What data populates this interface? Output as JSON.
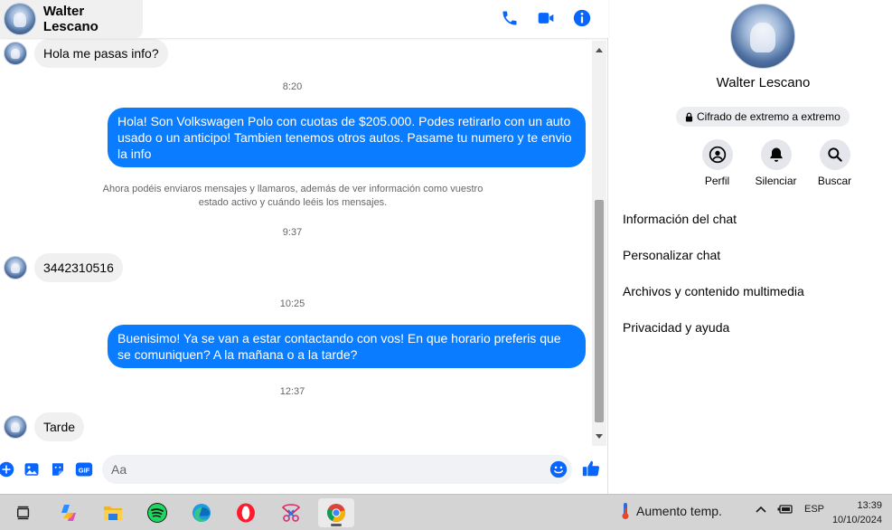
{
  "chat": {
    "contact_name": "Walter Lescano",
    "messages": [
      {
        "direction": "in",
        "text": "Hola me pasas info?"
      },
      {
        "timestamp": "8:20"
      },
      {
        "direction": "out",
        "text": "Hola! Son Volkswagen Polo con cuotas de $205.000. Podes retirarlo con un auto usado o un anticipo! Tambien tenemos otros autos. Pasame tu numero y te envio la info"
      },
      {
        "notice": "Ahora podéis enviaros mensajes y llamaros, además de ver información como vuestro estado activo y cuándo leéis los mensajes."
      },
      {
        "timestamp": "9:37"
      },
      {
        "direction": "in",
        "text": "3442310516"
      },
      {
        "timestamp": "10:25"
      },
      {
        "direction": "out",
        "text": "Buenisimo! Ya se van a estar contactando con vos! En que horario preferis que se comuniquen? A la mañana o a la tarde?"
      },
      {
        "timestamp": "12:37"
      },
      {
        "direction": "in",
        "text": "Tarde"
      }
    ],
    "composer_placeholder": "Aa",
    "gif_label": "GIF"
  },
  "info_panel": {
    "name": "Walter Lescano",
    "encryption_badge": "Cifrado de extremo a extremo",
    "actions": [
      {
        "label": "Perfil",
        "icon": "profile-icon"
      },
      {
        "label": "Silenciar",
        "icon": "bell-icon"
      },
      {
        "label": "Buscar",
        "icon": "search-icon"
      }
    ],
    "menu": [
      "Información del chat",
      "Personalizar chat",
      "Archivos y contenido multimedia",
      "Privacidad y ayuda"
    ]
  },
  "taskbar": {
    "apps": [
      "task-view-icon",
      "copilot-icon",
      "file-explorer-icon",
      "spotify-icon",
      "edge-icon",
      "opera-icon",
      "snipping-tool-icon",
      "chrome-icon"
    ],
    "weather_text": "Aumento temp.",
    "language": "ESP",
    "time": "13:39",
    "date": "10/10/2024"
  },
  "colors": {
    "accent": "#0a7cff",
    "incoming_bubble": "#f0f0f0",
    "messenger_blue": "#0866ff"
  }
}
